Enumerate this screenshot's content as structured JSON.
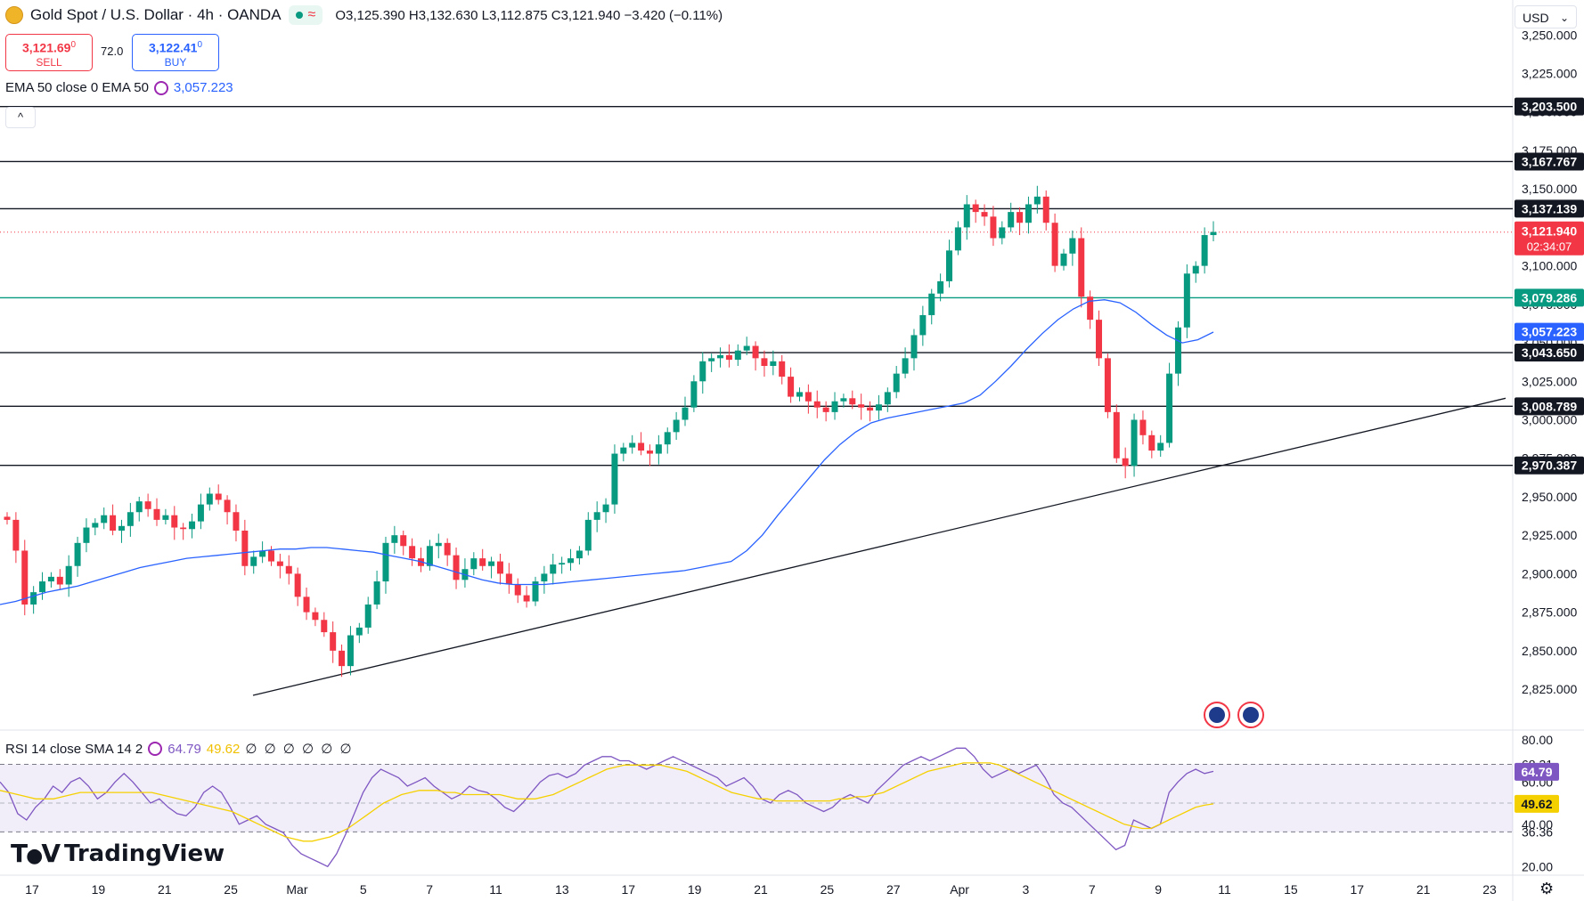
{
  "header": {
    "title": "Gold Spot / U.S. Dollar · 4h · OANDA",
    "ohlc": "O3,125.390 H3,132.630 L3,112.875 C3,121.940 −3.420 (−0.11%)",
    "wave_icon": "≈"
  },
  "trade": {
    "sell_price": "3,121.69",
    "sell_sup": "0",
    "sell_label": "SELL",
    "spread": "72.0",
    "buy_price": "3,122.41",
    "buy_sup": "0",
    "buy_label": "BUY"
  },
  "ema_legend": {
    "label": "EMA 50 close 0 EMA 50",
    "value": "3,057.223"
  },
  "rsi_legend": {
    "label": "RSI 14 close SMA 14 2",
    "rsi": "64.79",
    "sma": "49.62",
    "extra": "∅ ∅ ∅ ∅ ∅ ∅"
  },
  "currency": "USD",
  "branding": "TradingView",
  "collapse_icon": "^",
  "chart_data": {
    "type": "line",
    "price_axis_ticks": [
      3250,
      3225,
      3200,
      3175,
      3150,
      3125,
      3100,
      3075,
      3050,
      3025,
      3000,
      2975,
      2950,
      2925,
      2900,
      2875,
      2850,
      2825
    ],
    "price_axis_tick_labels": [
      "3,250.000",
      "3,225.000",
      "3,200.000",
      "3,175.000",
      "3,150.000",
      "3,125.000",
      "3,100.000",
      "3,075.000",
      "3,050.000",
      "3,025.000",
      "3,000.000",
      "2,975.000",
      "2,950.000",
      "2,925.000",
      "2,900.000",
      "2,875.000",
      "2,850.000",
      "2,825.000"
    ],
    "price_range": [
      2810,
      3260
    ],
    "time_axis_labels": [
      "17",
      "19",
      "21",
      "25",
      "Mar",
      "5",
      "7",
      "11",
      "13",
      "17",
      "19",
      "21",
      "25",
      "27",
      "Apr",
      "3",
      "7",
      "9",
      "11",
      "15",
      "17",
      "21",
      "23"
    ],
    "horizontal_levels": [
      {
        "value": 3203.5,
        "label": "3,203.500",
        "color": "#131722"
      },
      {
        "value": 3167.767,
        "label": "3,167.767",
        "color": "#131722"
      },
      {
        "value": 3137.139,
        "label": "3,137.139",
        "color": "#131722"
      },
      {
        "value": 3079.286,
        "label": "3,079.286",
        "color": "#089981"
      },
      {
        "value": 3043.65,
        "label": "3,043.650",
        "color": "#131722"
      },
      {
        "value": 3008.789,
        "label": "3,008.789",
        "color": "#131722"
      },
      {
        "value": 2970.387,
        "label": "2,970.387",
        "color": "#131722"
      }
    ],
    "current_price": {
      "value": 3121.94,
      "label": "3,121.940",
      "countdown": "02:34:07",
      "color": "#f23645"
    },
    "ema_label": {
      "value": 3057.223,
      "label": "3,057.223",
      "color": "#2962ff"
    },
    "trendline": {
      "start": [
        0,
        2821
      ],
      "end": [
        1.0,
        3014
      ]
    },
    "candles_close": [
      2935,
      2915,
      2880,
      2888,
      2895,
      2898,
      2893,
      2905,
      2920,
      2930,
      2933,
      2938,
      2928,
      2931,
      2940,
      2947,
      2942,
      2935,
      2938,
      2930,
      2929,
      2934,
      2945,
      2952,
      2948,
      2940,
      2928,
      2905,
      2911,
      2915,
      2908,
      2905,
      2900,
      2885,
      2875,
      2870,
      2862,
      2850,
      2840,
      2860,
      2865,
      2880,
      2895,
      2920,
      2925,
      2918,
      2910,
      2905,
      2918,
      2920,
      2912,
      2896,
      2903,
      2910,
      2905,
      2908,
      2900,
      2893,
      2886,
      2882,
      2895,
      2900,
      2906,
      2907,
      2910,
      2915,
      2935,
      2940,
      2945,
      2978,
      2982,
      2985,
      2980,
      2978,
      2984,
      2992,
      3000,
      3008,
      3025,
      3038,
      3040,
      3042,
      3039,
      3045,
      3048,
      3040,
      3035,
      3038,
      3028,
      3015,
      3018,
      3012,
      3008,
      3005,
      3012,
      3014,
      3010,
      3008,
      3006,
      3010,
      3018,
      3030,
      3040,
      3055,
      3068,
      3082,
      3090,
      3110,
      3125,
      3140,
      3135,
      3132,
      3118,
      3125,
      3135,
      3128,
      3140,
      3145,
      3128,
      3100,
      3108,
      3118,
      3080,
      3065,
      3040,
      3005,
      2975,
      2970,
      3000,
      2990,
      2980,
      2985,
      3030,
      3060,
      3095,
      3100,
      3120,
      3122
    ],
    "ema_series": [
      2880,
      2882,
      2885,
      2888,
      2890,
      2892,
      2895,
      2898,
      2901,
      2904,
      2906,
      2908,
      2910,
      2911,
      2912,
      2913,
      2914,
      2915,
      2916,
      2916,
      2917,
      2917,
      2916,
      2915,
      2914,
      2912,
      2910,
      2908,
      2905,
      2902,
      2899,
      2896,
      2894,
      2893,
      2893,
      2893,
      2894,
      2895,
      2896,
      2897,
      2898,
      2899,
      2900,
      2901,
      2902,
      2904,
      2906,
      2908,
      2915,
      2925,
      2938,
      2950,
      2962,
      2974,
      2984,
      2992,
      2998,
      3001,
      3003,
      3005,
      3007,
      3009,
      3011,
      3016,
      3025,
      3035,
      3046,
      3056,
      3065,
      3072,
      3077,
      3078,
      3076,
      3070,
      3062,
      3055,
      3050,
      3052,
      3057
    ],
    "rsi": {
      "title": "RSI 14 close SMA 14 2",
      "axis_labels": [
        "80.00",
        "68.31",
        "60.00",
        "49.62",
        "40.00",
        "36.36",
        "20.00"
      ],
      "upper_band": 68.31,
      "lower_band": 36.36,
      "range": [
        18,
        82
      ],
      "rsi_values": [
        60,
        55,
        45,
        42,
        48,
        52,
        58,
        55,
        60,
        62,
        58,
        52,
        55,
        60,
        64,
        60,
        55,
        50,
        52,
        48,
        45,
        44,
        48,
        55,
        58,
        55,
        48,
        40,
        42,
        44,
        40,
        38,
        36,
        30,
        26,
        24,
        22,
        20,
        26,
        35,
        45,
        55,
        62,
        66,
        64,
        62,
        58,
        60,
        62,
        58,
        55,
        52,
        54,
        58,
        56,
        55,
        52,
        48,
        46,
        50,
        55,
        60,
        63,
        64,
        62,
        64,
        68,
        70,
        72,
        72,
        70,
        70,
        68,
        66,
        68,
        70,
        72,
        70,
        68,
        66,
        64,
        62,
        58,
        60,
        62,
        58,
        52,
        50,
        54,
        56,
        54,
        50,
        48,
        46,
        48,
        52,
        54,
        52,
        50,
        56,
        60,
        64,
        68,
        70,
        72,
        70,
        72,
        74,
        76,
        76,
        72,
        66,
        62,
        64,
        66,
        64,
        66,
        68,
        62,
        54,
        50,
        48,
        44,
        40,
        36,
        32,
        28,
        30,
        42,
        40,
        38,
        40,
        55,
        60,
        64,
        66,
        64,
        65
      ],
      "sma_values": [
        56,
        55,
        54,
        53,
        52,
        52,
        52,
        53,
        54,
        55,
        55,
        55,
        55,
        55,
        55,
        55,
        55,
        55,
        54,
        53,
        52,
        51,
        50,
        49,
        48,
        47,
        46,
        44,
        42,
        40,
        38,
        36,
        34,
        33,
        32,
        32,
        33,
        34,
        36,
        38,
        41,
        44,
        47,
        50,
        52,
        54,
        55,
        56,
        56,
        56,
        55,
        55,
        54,
        54,
        54,
        54,
        54,
        53,
        52,
        52,
        52,
        53,
        54,
        56,
        58,
        60,
        62,
        64,
        66,
        67,
        68,
        68,
        68,
        68,
        68,
        67,
        66,
        65,
        63,
        61,
        59,
        57,
        55,
        54,
        53,
        52,
        52,
        51,
        51,
        51,
        51,
        51,
        51,
        51,
        52,
        52,
        53,
        53,
        54,
        55,
        57,
        59,
        61,
        63,
        65,
        66,
        67,
        68,
        69,
        69,
        69,
        69,
        68,
        66,
        64,
        62,
        60,
        58,
        56,
        54,
        52,
        50,
        48,
        46,
        44,
        42,
        40,
        39,
        38,
        38,
        40,
        42,
        44,
        46,
        48,
        49,
        49.62
      ]
    }
  }
}
